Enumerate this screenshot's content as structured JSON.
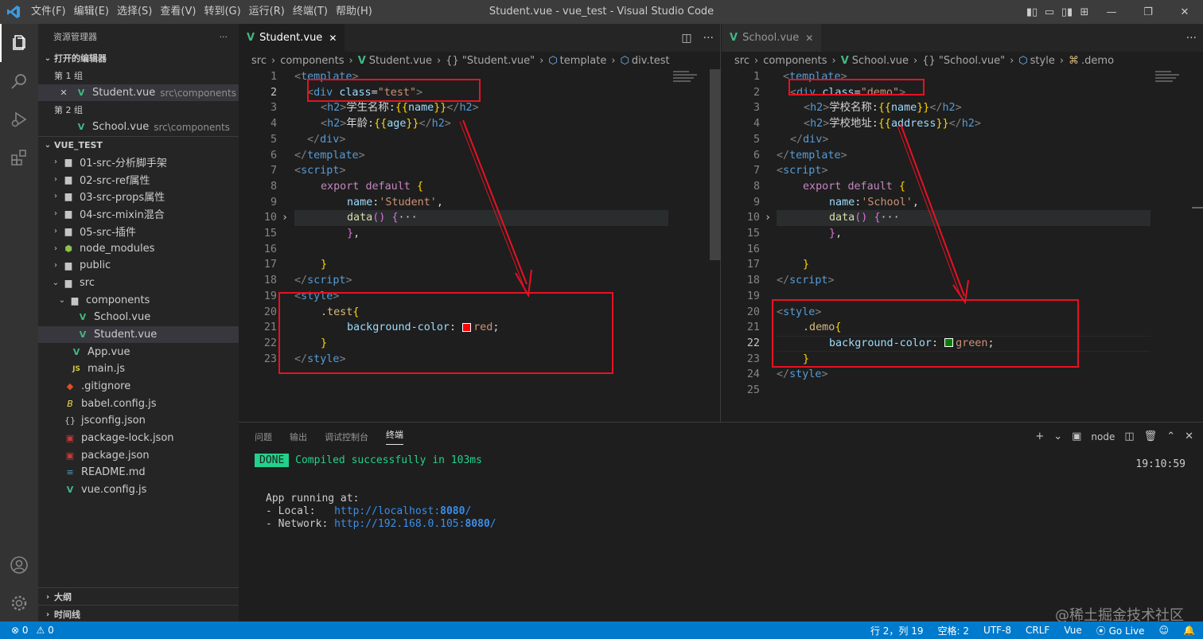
{
  "titlebar": {
    "menu": [
      "文件(F)",
      "编辑(E)",
      "选择(S)",
      "查看(V)",
      "转到(G)",
      "运行(R)",
      "终端(T)",
      "帮助(H)"
    ],
    "title": "Student.vue - vue_test - Visual Studio Code"
  },
  "sidebar": {
    "header": "资源管理器",
    "more": "···",
    "open_editors": "打开的编辑器",
    "group1": "第 1 组",
    "group2": "第 2 组",
    "open_files": [
      {
        "name": "Student.vue",
        "desc": "src\\components"
      },
      {
        "name": "School.vue",
        "desc": "src\\components"
      }
    ],
    "project": "VUE_TEST",
    "tree": [
      {
        "label": "01-src-分析脚手架"
      },
      {
        "label": "02-src-ref属性"
      },
      {
        "label": "03-src-props属性"
      },
      {
        "label": "04-src-mixin混合"
      },
      {
        "label": "05-src-插件"
      },
      {
        "label": "node_modules"
      },
      {
        "label": "public"
      },
      {
        "label": "src"
      },
      {
        "label": "components"
      },
      {
        "label": "School.vue"
      },
      {
        "label": "Student.vue"
      },
      {
        "label": "App.vue"
      },
      {
        "label": "main.js"
      },
      {
        "label": ".gitignore"
      },
      {
        "label": "babel.config.js"
      },
      {
        "label": "jsconfig.json"
      },
      {
        "label": "package-lock.json"
      },
      {
        "label": "package.json"
      },
      {
        "label": "README.md"
      },
      {
        "label": "vue.config.js"
      }
    ],
    "outline": "大纲",
    "timeline": "时间线"
  },
  "left_editor": {
    "tab": "Student.vue",
    "close": "✕",
    "breadcrumb": [
      "src",
      "components",
      "Student.vue",
      "{} \"Student.vue\"",
      "template",
      "div.test"
    ],
    "line_numbers": [
      "1",
      "2",
      "3",
      "4",
      "5",
      "6",
      "7",
      "8",
      "9",
      "10",
      "15",
      "16",
      "17",
      "18",
      "19",
      "20",
      "21",
      "22",
      "23"
    ],
    "code": {
      "class_value": "\"test\"",
      "h2_1": "学生名称:",
      "h2_2": "年龄:",
      "var1": "name",
      "var2": "age",
      "name_value": "'Student'",
      "selector": ".test",
      "color_value": "red"
    }
  },
  "right_editor": {
    "tab": "School.vue",
    "close": "✕",
    "breadcrumb": [
      "src",
      "components",
      "School.vue",
      "{} \"School.vue\"",
      "style",
      ".demo"
    ],
    "line_numbers": [
      "1",
      "2",
      "3",
      "4",
      "5",
      "6",
      "7",
      "8",
      "9",
      "10",
      "15",
      "16",
      "17",
      "18",
      "19",
      "20",
      "21",
      "22",
      "23",
      "24",
      "25"
    ],
    "code": {
      "class_value": "\"demo\"",
      "h2_1": "学校名称:",
      "h2_2": "学校地址:",
      "var1": "name",
      "var2": "address",
      "name_value": "'School'",
      "selector": ".demo",
      "color_value": "green"
    }
  },
  "panel": {
    "tabs": [
      "问题",
      "输出",
      "调试控制台",
      "终端"
    ],
    "terminal_name": "node",
    "time": "19:10:59",
    "done": "DONE",
    "compiled": "Compiled successfully in 103ms",
    "app_running": "App running at:",
    "local_label": "- Local:   ",
    "local_url_pre": "http://localhost:",
    "local_port": "8080",
    "network_label": "- Network: ",
    "network_url_pre": "http://192.168.0.105:",
    "network_port": "8080",
    "slash": "/"
  },
  "watermark": "@稀土掘金技术社区",
  "statusbar": {
    "errors": "⊗ 0",
    "warnings": "⚠ 0",
    "position": "行 2，列 19",
    "spaces": "空格: 2",
    "encoding": "UTF-8",
    "eol": "CRLF",
    "language": "Vue",
    "golive": "Go Live"
  },
  "colors": {
    "accent": "#007acc",
    "red_annotation": "#e81123",
    "swatch_red": "#ff0000",
    "swatch_green": "#008000"
  }
}
